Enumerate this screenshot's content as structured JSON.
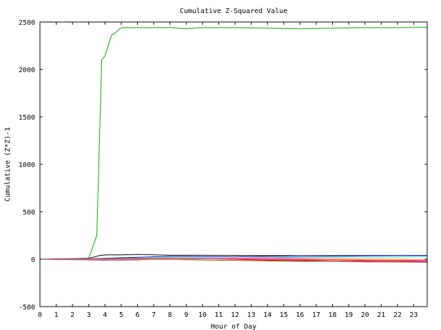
{
  "chart_data": {
    "type": "line",
    "title": "Cumulative Z-Squared Value",
    "xlabel": "Hour of Day",
    "ylabel": "Cumulative (Z*Z)-1",
    "xlim": [
      0,
      23.83
    ],
    "ylim": [
      -500,
      2500
    ],
    "xticks": [
      0,
      1,
      2,
      3,
      4,
      5,
      6,
      7,
      8,
      9,
      10,
      11,
      12,
      13,
      14,
      15,
      16,
      17,
      18,
      19,
      20,
      21,
      22,
      23
    ],
    "yticks": [
      -500,
      0,
      500,
      1000,
      1500,
      2000,
      2500
    ],
    "grid": false,
    "legend": "none",
    "series": [
      {
        "color": "#00aa00",
        "x": [
          0,
          1,
          2,
          3,
          3.5,
          3.8,
          4.0,
          4.4,
          4.6,
          4.9,
          5.1,
          6,
          8,
          9,
          10,
          12,
          14,
          16,
          18,
          20,
          22,
          23.83
        ],
        "y": [
          0,
          2,
          6,
          10,
          250,
          2100,
          2140,
          2360,
          2380,
          2430,
          2440,
          2440,
          2440,
          2430,
          2440,
          2440,
          2435,
          2430,
          2435,
          2440,
          2440,
          2445
        ]
      },
      {
        "color": "#000000",
        "x": [
          0,
          1,
          2,
          3,
          3.7,
          4.1,
          5,
          6,
          8,
          10,
          12,
          14,
          16,
          18,
          20,
          22,
          23.83
        ],
        "y": [
          0,
          4,
          6,
          8,
          40,
          45,
          45,
          50,
          42,
          42,
          40,
          38,
          36,
          38,
          40,
          40,
          40
        ]
      },
      {
        "color": "#0000cc",
        "x": [
          0,
          2,
          4,
          6,
          8,
          10,
          12,
          14,
          16,
          18,
          20,
          22,
          23.83
        ],
        "y": [
          0,
          -2,
          10,
          20,
          30,
          28,
          25,
          30,
          35,
          35,
          38,
          40,
          40
        ]
      },
      {
        "color": "#cc00cc",
        "x": [
          0,
          2,
          4,
          6,
          8,
          10,
          12,
          14,
          16,
          18,
          20,
          22,
          23.83
        ],
        "y": [
          0,
          -5,
          -10,
          -8,
          5,
          10,
          5,
          0,
          -5,
          -10,
          -15,
          -20,
          -25
        ]
      },
      {
        "color": "#dd0000",
        "x": [
          0,
          2,
          4,
          6,
          8,
          10,
          12,
          14,
          16,
          18,
          20,
          22,
          23.83
        ],
        "y": [
          0,
          -3,
          -6,
          2,
          8,
          5,
          0,
          -10,
          -15,
          -10,
          -20,
          -18,
          -15
        ]
      },
      {
        "color": "#00bbbb",
        "x": [
          0,
          2,
          4,
          6,
          8,
          10,
          12,
          14,
          16,
          18,
          20,
          22,
          23.83
        ],
        "y": [
          0,
          3,
          5,
          10,
          15,
          12,
          10,
          15,
          20,
          22,
          25,
          25,
          28
        ]
      },
      {
        "color": "#ff8800",
        "x": [
          0,
          2,
          4,
          6,
          8,
          10,
          12,
          14,
          16,
          18,
          20,
          22,
          23.83
        ],
        "y": [
          0,
          -1,
          2,
          5,
          8,
          6,
          10,
          12,
          8,
          5,
          2,
          0,
          -3
        ]
      },
      {
        "color": "#884400",
        "x": [
          0,
          2,
          4,
          6,
          8,
          10,
          12,
          14,
          16,
          18,
          20,
          22,
          23.83
        ],
        "y": [
          0,
          -2,
          -4,
          0,
          -3,
          -8,
          -12,
          -18,
          -22,
          -25,
          -28,
          -30,
          -32
        ]
      },
      {
        "color": "#ff66aa",
        "x": [
          0,
          2,
          4,
          6,
          8,
          10,
          12,
          14,
          16,
          18,
          20,
          22,
          23.83
        ],
        "y": [
          0,
          1,
          -2,
          -5,
          -2,
          3,
          8,
          5,
          0,
          -5,
          -8,
          -10,
          -12
        ]
      }
    ]
  }
}
